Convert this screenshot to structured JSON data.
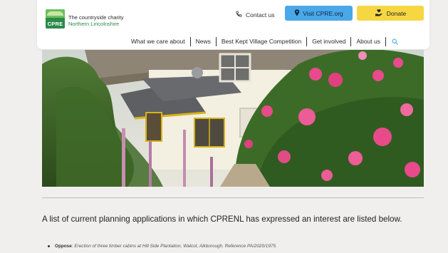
{
  "header": {
    "logo_text": "CPRE",
    "brand_line1": "The countryside charity",
    "brand_line2": "Northern Lincolnshire",
    "contact_label": "Contact us",
    "visit_label": "Visit CPRE.org",
    "donate_label": "Donate"
  },
  "nav": {
    "items": [
      "What we care about",
      "News",
      "Best Kept Village Competition",
      "Get involved",
      "About us"
    ]
  },
  "main": {
    "intro": "A list of current planning applications in which CPRENL has expressed an interest are listed below.",
    "list": [
      {
        "label": "Oppose",
        "text": ": Erection of three timber cabins at Hill Side Plantation, Walcot, Alkborough. Reference PA/2020/1975."
      }
    ]
  },
  "colors": {
    "visit_button": "#4aa7e8",
    "donate_button": "#f6d743",
    "brand_green": "#2a8a4a",
    "background": "#f1efed"
  },
  "icons": {
    "contact": "phone-icon",
    "visit": "map-pin-icon",
    "donate": "hand-heart-icon",
    "search": "search-icon"
  }
}
